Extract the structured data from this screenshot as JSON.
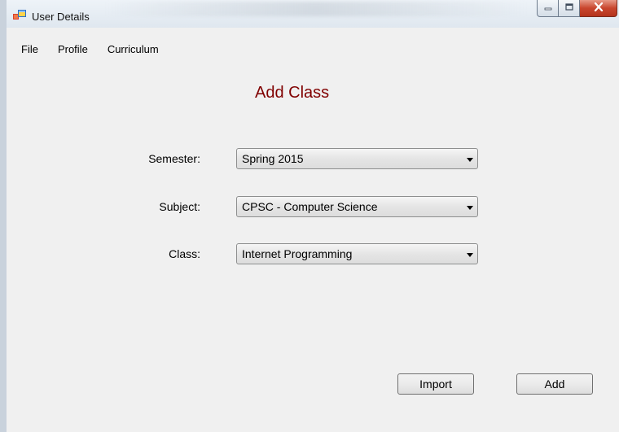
{
  "window": {
    "title": "User Details",
    "controls": {
      "minimize_icon": "minimize-icon",
      "maximize_icon": "maximize-icon",
      "close_icon": "close-icon"
    }
  },
  "menu": {
    "items": [
      {
        "label": "File"
      },
      {
        "label": "Profile"
      },
      {
        "label": "Curriculum"
      }
    ]
  },
  "form": {
    "title": "Add Class",
    "title_color": "#800000",
    "fields": [
      {
        "label": "Semester:",
        "value": "Spring 2015"
      },
      {
        "label": "Subject:",
        "value": "CPSC - Computer Science"
      },
      {
        "label": "Class:",
        "value": "Internet Programming"
      }
    ],
    "buttons": {
      "import_label": "Import",
      "add_label": "Add"
    }
  }
}
